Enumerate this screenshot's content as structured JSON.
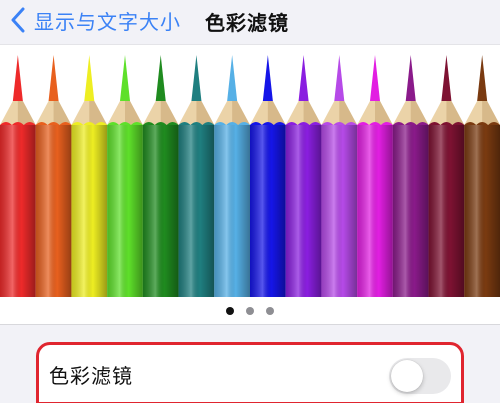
{
  "nav": {
    "back_label": "显示与文字大小",
    "title": "色彩滤镜"
  },
  "preview": {
    "pencil_colors": [
      "#ee2a2a",
      "#e8601e",
      "#eeee22",
      "#5ee02a",
      "#1f8b1f",
      "#1f7f80",
      "#56b0e6",
      "#1515e8",
      "#8a1ee0",
      "#b64ae8",
      "#e21ee2",
      "#8a1a8a",
      "#7e1232",
      "#7a3a10"
    ],
    "pages": 3,
    "active_page": 0
  },
  "setting": {
    "label": "色彩滤镜",
    "enabled": false
  },
  "colors": {
    "accent": "#3b82f6",
    "highlight_box": "#e0252f",
    "toggle_off": "#e9e9eb"
  }
}
